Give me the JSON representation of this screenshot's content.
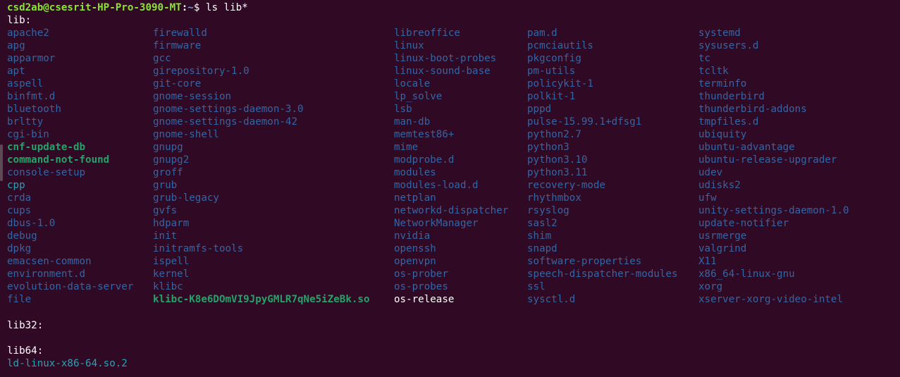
{
  "prompt": {
    "user_host": "csd2ab@csesrit-HP-Pro-3090-MT",
    "separator": ":",
    "path": "~",
    "dollar": "$",
    "command": " ls lib*"
  },
  "headers": {
    "lib": "lib:",
    "lib32": "lib32:",
    "lib64": "lib64:"
  },
  "colors": {
    "background": "#300a24",
    "directory": "#3465a4",
    "executable": "#26a269",
    "symlink": "#2aa1b3",
    "plain": "#ffffff"
  },
  "lib_columns": [
    [
      {
        "name": "apache2",
        "type": "dir"
      },
      {
        "name": "apg",
        "type": "dir"
      },
      {
        "name": "apparmor",
        "type": "dir"
      },
      {
        "name": "apt",
        "type": "dir"
      },
      {
        "name": "aspell",
        "type": "dir"
      },
      {
        "name": "binfmt.d",
        "type": "dir"
      },
      {
        "name": "bluetooth",
        "type": "dir"
      },
      {
        "name": "brltty",
        "type": "dir"
      },
      {
        "name": "cgi-bin",
        "type": "dir"
      },
      {
        "name": "cnf-update-db",
        "type": "exec"
      },
      {
        "name": "command-not-found",
        "type": "exec"
      },
      {
        "name": "console-setup",
        "type": "dir"
      },
      {
        "name": "cpp",
        "type": "link"
      },
      {
        "name": "crda",
        "type": "dir"
      },
      {
        "name": "cups",
        "type": "dir"
      },
      {
        "name": "dbus-1.0",
        "type": "dir"
      },
      {
        "name": "debug",
        "type": "dir"
      },
      {
        "name": "dpkg",
        "type": "dir"
      },
      {
        "name": "emacsen-common",
        "type": "dir"
      },
      {
        "name": "environment.d",
        "type": "dir"
      },
      {
        "name": "evolution-data-server",
        "type": "dir"
      },
      {
        "name": "file",
        "type": "dir"
      }
    ],
    [
      {
        "name": "firewalld",
        "type": "dir"
      },
      {
        "name": "firmware",
        "type": "dir"
      },
      {
        "name": "gcc",
        "type": "dir"
      },
      {
        "name": "girepository-1.0",
        "type": "dir"
      },
      {
        "name": "git-core",
        "type": "dir"
      },
      {
        "name": "gnome-session",
        "type": "dir"
      },
      {
        "name": "gnome-settings-daemon-3.0",
        "type": "dir"
      },
      {
        "name": "gnome-settings-daemon-42",
        "type": "dir"
      },
      {
        "name": "gnome-shell",
        "type": "dir"
      },
      {
        "name": "gnupg",
        "type": "dir"
      },
      {
        "name": "gnupg2",
        "type": "dir"
      },
      {
        "name": "groff",
        "type": "dir"
      },
      {
        "name": "grub",
        "type": "dir"
      },
      {
        "name": "grub-legacy",
        "type": "dir"
      },
      {
        "name": "gvfs",
        "type": "dir"
      },
      {
        "name": "hdparm",
        "type": "dir"
      },
      {
        "name": "init",
        "type": "dir"
      },
      {
        "name": "initramfs-tools",
        "type": "dir"
      },
      {
        "name": "ispell",
        "type": "dir"
      },
      {
        "name": "kernel",
        "type": "dir"
      },
      {
        "name": "klibc",
        "type": "dir"
      },
      {
        "name": "klibc-K8e6DOmVI9JpyGMLR7qNe5iZeBk.so",
        "type": "exec"
      }
    ],
    [
      {
        "name": "libreoffice",
        "type": "dir"
      },
      {
        "name": "linux",
        "type": "dir"
      },
      {
        "name": "linux-boot-probes",
        "type": "dir"
      },
      {
        "name": "linux-sound-base",
        "type": "dir"
      },
      {
        "name": "locale",
        "type": "dir"
      },
      {
        "name": "lp_solve",
        "type": "dir"
      },
      {
        "name": "lsb",
        "type": "dir"
      },
      {
        "name": "man-db",
        "type": "dir"
      },
      {
        "name": "memtest86+",
        "type": "dir"
      },
      {
        "name": "mime",
        "type": "dir"
      },
      {
        "name": "modprobe.d",
        "type": "dir"
      },
      {
        "name": "modules",
        "type": "dir"
      },
      {
        "name": "modules-load.d",
        "type": "dir"
      },
      {
        "name": "netplan",
        "type": "dir"
      },
      {
        "name": "networkd-dispatcher",
        "type": "dir"
      },
      {
        "name": "NetworkManager",
        "type": "dir"
      },
      {
        "name": "nvidia",
        "type": "dir"
      },
      {
        "name": "openssh",
        "type": "dir"
      },
      {
        "name": "openvpn",
        "type": "dir"
      },
      {
        "name": "os-prober",
        "type": "dir"
      },
      {
        "name": "os-probes",
        "type": "dir"
      },
      {
        "name": "os-release",
        "type": "plain"
      }
    ],
    [
      {
        "name": "pam.d",
        "type": "dir"
      },
      {
        "name": "pcmciautils",
        "type": "dir"
      },
      {
        "name": "pkgconfig",
        "type": "dir"
      },
      {
        "name": "pm-utils",
        "type": "dir"
      },
      {
        "name": "policykit-1",
        "type": "dir"
      },
      {
        "name": "polkit-1",
        "type": "dir"
      },
      {
        "name": "pppd",
        "type": "dir"
      },
      {
        "name": "pulse-15.99.1+dfsg1",
        "type": "dir"
      },
      {
        "name": "python2.7",
        "type": "dir"
      },
      {
        "name": "python3",
        "type": "dir"
      },
      {
        "name": "python3.10",
        "type": "dir"
      },
      {
        "name": "python3.11",
        "type": "dir"
      },
      {
        "name": "recovery-mode",
        "type": "dir"
      },
      {
        "name": "rhythmbox",
        "type": "dir"
      },
      {
        "name": "rsyslog",
        "type": "dir"
      },
      {
        "name": "sasl2",
        "type": "dir"
      },
      {
        "name": "shim",
        "type": "dir"
      },
      {
        "name": "snapd",
        "type": "dir"
      },
      {
        "name": "software-properties",
        "type": "dir"
      },
      {
        "name": "speech-dispatcher-modules",
        "type": "dir"
      },
      {
        "name": "ssl",
        "type": "dir"
      },
      {
        "name": "sysctl.d",
        "type": "dir"
      }
    ],
    [
      {
        "name": "systemd",
        "type": "dir"
      },
      {
        "name": "sysusers.d",
        "type": "dir"
      },
      {
        "name": "tc",
        "type": "dir"
      },
      {
        "name": "tcltk",
        "type": "dir"
      },
      {
        "name": "terminfo",
        "type": "dir"
      },
      {
        "name": "thunderbird",
        "type": "dir"
      },
      {
        "name": "thunderbird-addons",
        "type": "dir"
      },
      {
        "name": "tmpfiles.d",
        "type": "dir"
      },
      {
        "name": "ubiquity",
        "type": "dir"
      },
      {
        "name": "ubuntu-advantage",
        "type": "dir"
      },
      {
        "name": "ubuntu-release-upgrader",
        "type": "dir"
      },
      {
        "name": "udev",
        "type": "dir"
      },
      {
        "name": "udisks2",
        "type": "dir"
      },
      {
        "name": "ufw",
        "type": "dir"
      },
      {
        "name": "unity-settings-daemon-1.0",
        "type": "dir"
      },
      {
        "name": "update-notifier",
        "type": "dir"
      },
      {
        "name": "usrmerge",
        "type": "dir"
      },
      {
        "name": "valgrind",
        "type": "dir"
      },
      {
        "name": "X11",
        "type": "dir"
      },
      {
        "name": "x86_64-linux-gnu",
        "type": "dir"
      },
      {
        "name": "xorg",
        "type": "dir"
      },
      {
        "name": "xserver-xorg-video-intel",
        "type": "dir"
      }
    ]
  ],
  "lib64_entries": [
    {
      "name": "ld-linux-x86-64.so.2",
      "type": "link"
    }
  ]
}
